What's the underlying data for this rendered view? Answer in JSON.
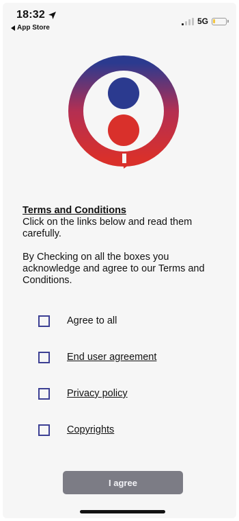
{
  "status_bar": {
    "time": "18:32",
    "back_app": "App Store",
    "network": "5G",
    "signal_bars_active": 1,
    "signal_bars_total": 4,
    "battery_level": 0.2
  },
  "icons": {
    "location": "location-arrow-icon",
    "back": "back-triangle-icon",
    "signal": "cellular-signal-icon",
    "battery": "battery-low-icon"
  },
  "terms": {
    "title": "Terms and Conditions",
    "instruction": "Click on the links below and read them carefully.",
    "acknowledge": "By Checking on all the boxes you acknowledge and agree to our Terms and Conditions."
  },
  "options": [
    {
      "label": "Agree to all",
      "checked": false,
      "is_link": false
    },
    {
      "label": "End user agreement",
      "checked": false,
      "is_link": true
    },
    {
      "label": "Privacy policy",
      "checked": false,
      "is_link": true
    },
    {
      "label": "Copyrights",
      "checked": false,
      "is_link": true
    }
  ],
  "agree_button": {
    "label": "I agree",
    "enabled": false
  },
  "colors": {
    "logo_blue": "#2b3a8f",
    "logo_red": "#d9302b",
    "checkbox_border": "#3c3f93",
    "button_disabled": "#7c7c85",
    "battery_fill": "#f3c63f",
    "signal_active": "#1c1c1c",
    "signal_inactive": "#c4c4c4"
  }
}
